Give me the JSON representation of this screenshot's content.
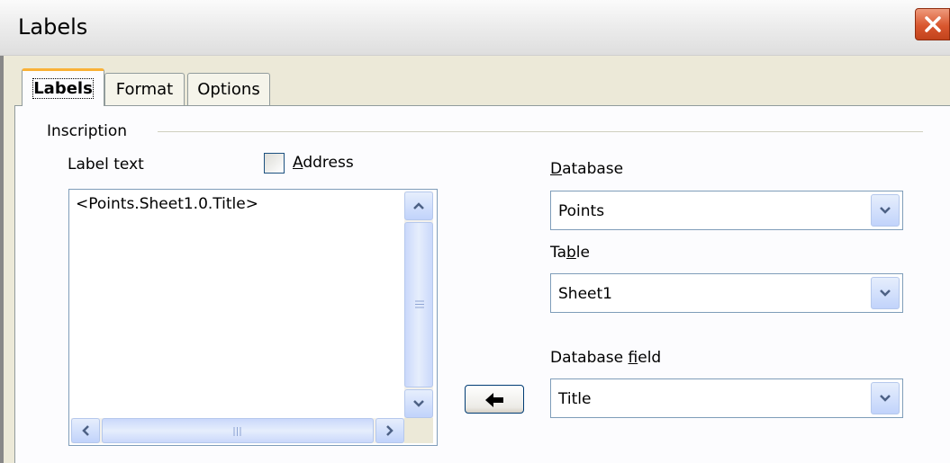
{
  "window": {
    "title": "Labels",
    "close_icon": "close-icon"
  },
  "tabs": [
    {
      "label": "Labels",
      "active": true
    },
    {
      "label": "Format",
      "active": false
    },
    {
      "label": "Options",
      "active": false
    }
  ],
  "inscription": {
    "group_label": "Inscription",
    "label_text_label": "Label text",
    "address_checkbox": {
      "label": "Address",
      "checked": false
    },
    "label_text_value": "<Points.Sheet1.0.Title>"
  },
  "database": {
    "label": "Database",
    "value": "Points"
  },
  "table": {
    "label": "Table",
    "value": "Sheet1"
  },
  "database_field": {
    "label": "Database field",
    "value": "Title"
  },
  "insert_button": {
    "icon": "arrow-left-icon"
  },
  "colors": {
    "close_red": "#d9572f",
    "tab_accent": "#f9b137",
    "scroll_blue": "#c1d3fb"
  }
}
